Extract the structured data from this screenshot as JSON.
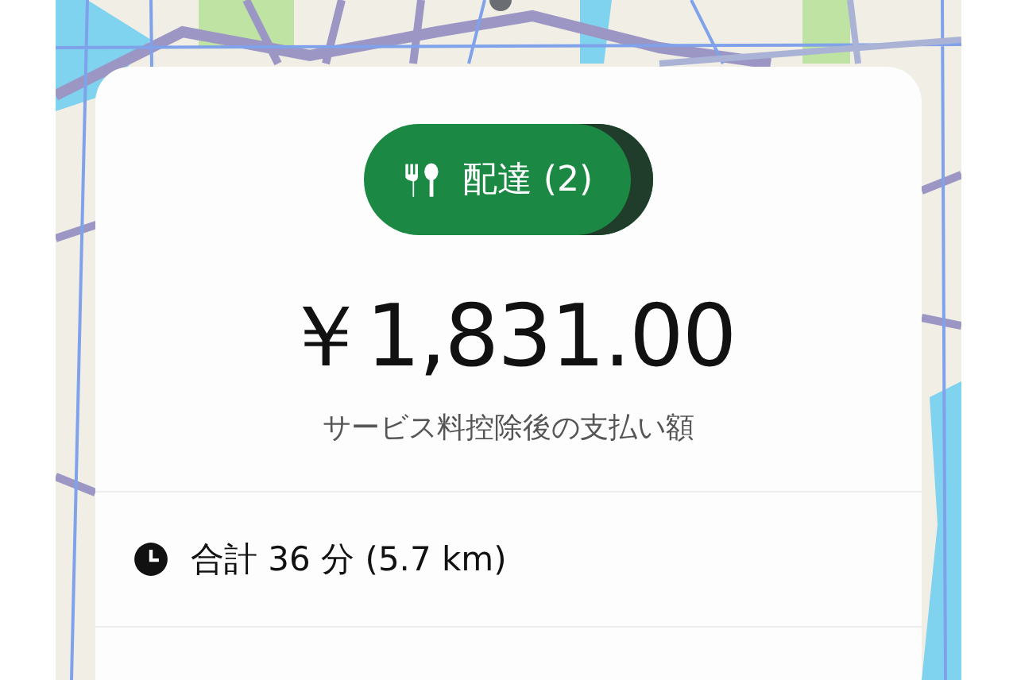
{
  "trip_card": {
    "badge": {
      "label": "配達 (2)"
    },
    "fare": "￥1,831.00",
    "fare_note": "サービス料控除後の支払い額",
    "summary": {
      "text": "合計 36 分 (5.7 km)"
    }
  }
}
